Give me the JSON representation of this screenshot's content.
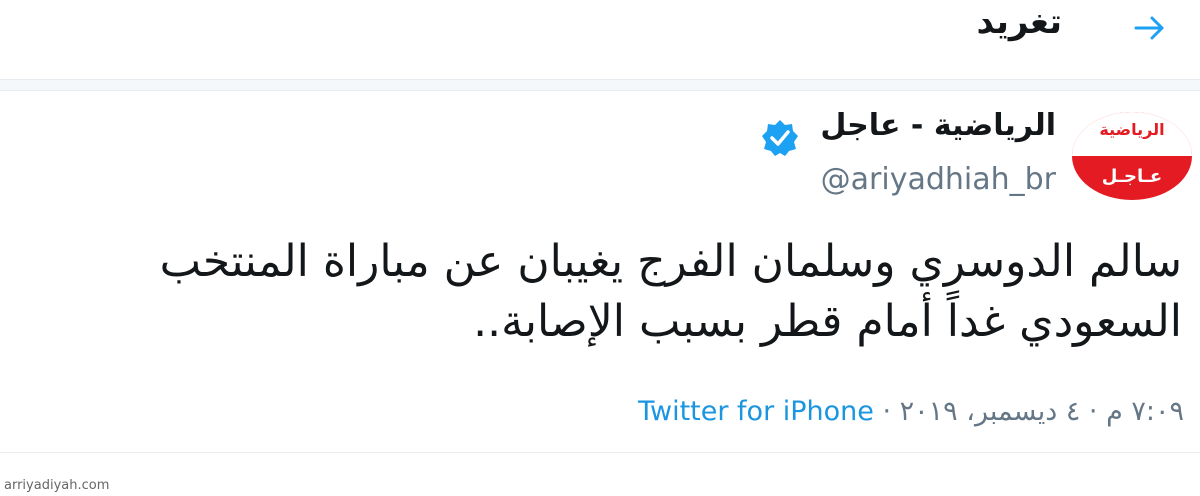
{
  "header": {
    "title": "تغريد",
    "back_icon": "arrow-right-icon"
  },
  "tweet": {
    "avatar": {
      "brand": "الرياضية",
      "sub": "عـاجـل"
    },
    "display_name": "الرياضية - عاجل",
    "verified_icon": "verified-badge-icon",
    "handle": "@ariyadhiah_br",
    "text": "سالم الدوسري وسلمان الفرج يغيبان عن مباراة المنتخب السعودي غداً أمام قطر بسبب الإصابة..",
    "timestamp": "٧:٠٩ م · ٤ ديسمبر، ٢٠١٩ · ",
    "source": "Twitter for iPhone"
  },
  "watermark": "arriyadiyah.com",
  "colors": {
    "accent": "#1da1f2",
    "link": "#1b95e0",
    "secondary_text": "#657786",
    "avatar_red": "#e41b23"
  }
}
